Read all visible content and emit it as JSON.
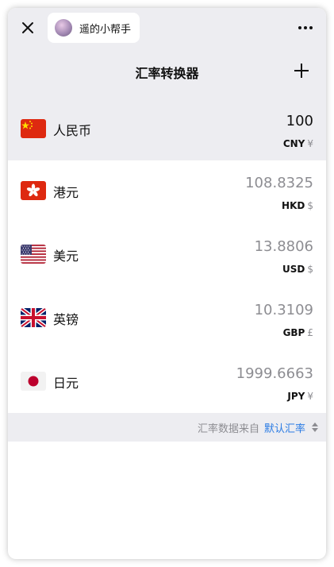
{
  "topbar": {
    "mini_program_name": "遥的小帮手",
    "title": "汇率转换器"
  },
  "currencies": [
    {
      "name": "人民币",
      "amount": "100",
      "code": "CNY",
      "symbol": "¥",
      "flag": "cn-flag"
    },
    {
      "name": "港元",
      "amount": "108.8325",
      "code": "HKD",
      "symbol": "$",
      "flag": "hk-flag"
    },
    {
      "name": "美元",
      "amount": "13.8806",
      "code": "USD",
      "symbol": "$",
      "flag": "us-flag"
    },
    {
      "name": "英镑",
      "amount": "10.3109",
      "code": "GBP",
      "symbol": "£",
      "flag": "gb-flag"
    },
    {
      "name": "日元",
      "amount": "1999.6663",
      "code": "JPY",
      "symbol": "¥",
      "flag": "jp-flag"
    }
  ],
  "footer": {
    "source_label": "汇率数据来自",
    "source_link": "默认汇率"
  },
  "colors": {
    "header_bg": "#ededf1",
    "link": "#2a7be4",
    "muted": "#8d8d92"
  }
}
